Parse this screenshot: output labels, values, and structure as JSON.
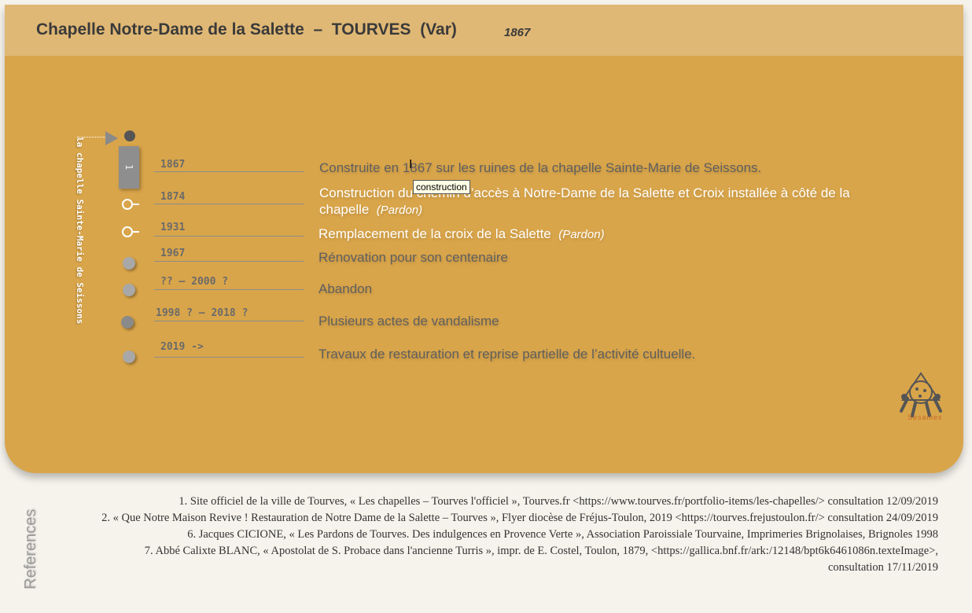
{
  "header": {
    "title": "Chapelle Notre-Dame de la Salette  –  TOURVES  (Var)",
    "year": "1867"
  },
  "vertical_label": "la chapelle Sainte-Marie de Seissons",
  "tab_marker_label": "1",
  "timeline": [
    {
      "year": "1867",
      "text": "Construite en 1867 sur les ruines de la chapelle Sainte-Marie de Seissons.",
      "note": ""
    },
    {
      "year": "1874",
      "text": "Construction du chemin d’accès à Notre-Dame de la Salette et Croix installée  à côté de la chapelle",
      "note": "(Pardon)"
    },
    {
      "year": "1931",
      "text": "Remplacement de la croix de la Salette",
      "note": "(Pardon)"
    },
    {
      "year": "1967",
      "text": "Rénovation pour son centenaire",
      "note": ""
    },
    {
      "year": "?? – 2000 ?",
      "text": "Abandon",
      "note": ""
    },
    {
      "year": "1998 ? – 2018 ?",
      "text": "Plusieurs actes de vandalisme",
      "note": ""
    },
    {
      "year": "2019 ->",
      "text": "Travaux de restauration et reprise partielle de l’activité cultuelle.",
      "note": ""
    }
  ],
  "tooltip": "construction",
  "logo_text": "Sesames",
  "references_label": "References",
  "references": [
    "1.   Site officiel de la ville de Tourves, « Les chapelles – Tourves l'officiel », Tourves.fr  <https://www.tourves.fr/portfolio-items/les-chapelles/> consultation 12/09/2019",
    "2.   « Que Notre Maison Revive ! Restauration de Notre Dame de la Salette – Tourves », Flyer diocèse de Fréjus-Toulon, 2019 <https://tourves.frejustoulon.fr/> consultation 24/09/2019",
    "6.   Jacques CICIONE, « Les Pardons de Tourves. Des indulgences en Provence Verte », Association Paroissiale Tourvaine, Imprimeries Brignolaises, Brignoles 1998",
    "7.   Abbé Calixte BLANC, «  Apostolat de S. Probace dans l'ancienne Turris », impr. de E. Costel, Toulon, 1879, <https://gallica.bnf.fr/ark:/12148/bpt6k6461086n.texteImage>, consultation 17/11/2019"
  ]
}
